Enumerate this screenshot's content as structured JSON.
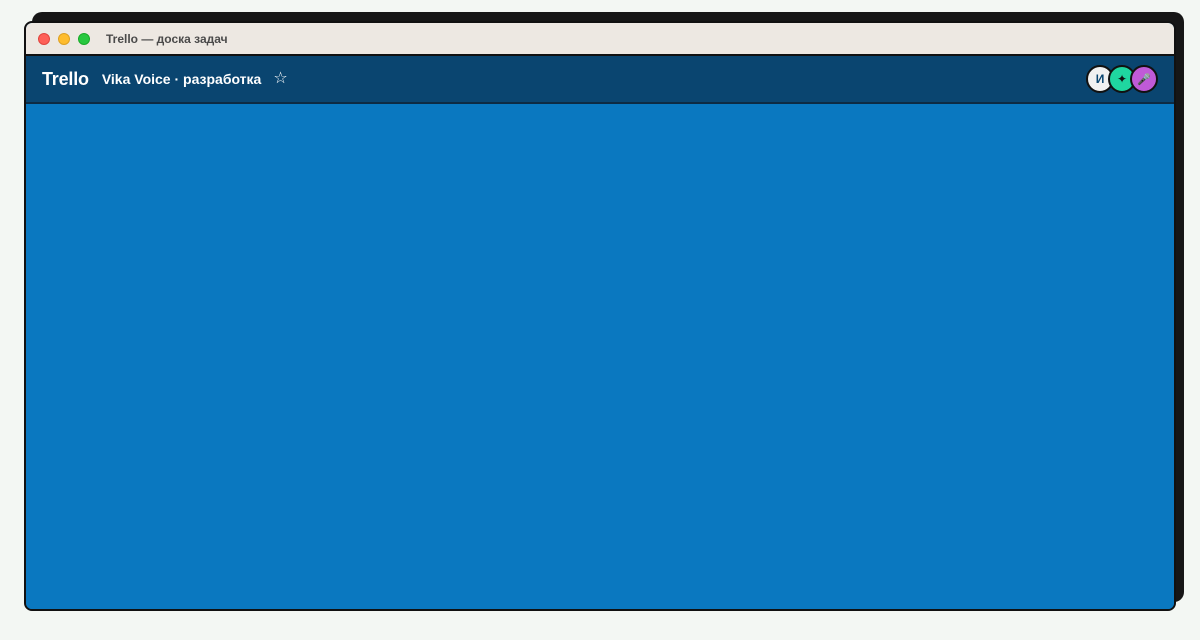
{
  "window": {
    "title": "Trello — доска задач"
  },
  "header": {
    "logo": "Trello",
    "board_name": "Vika Voice · разработка",
    "star_glyph": "☆"
  },
  "members": [
    {
      "initial": "И",
      "icon": "letter-avatar"
    },
    {
      "initial": "✦",
      "icon": "sparkle-icon"
    },
    {
      "initial": "🎤",
      "icon": "microphone-icon"
    }
  ],
  "colors": {
    "board_background": "#0a78c0",
    "header_background": "#0a4570",
    "titlebar_background": "#ede8e2"
  }
}
